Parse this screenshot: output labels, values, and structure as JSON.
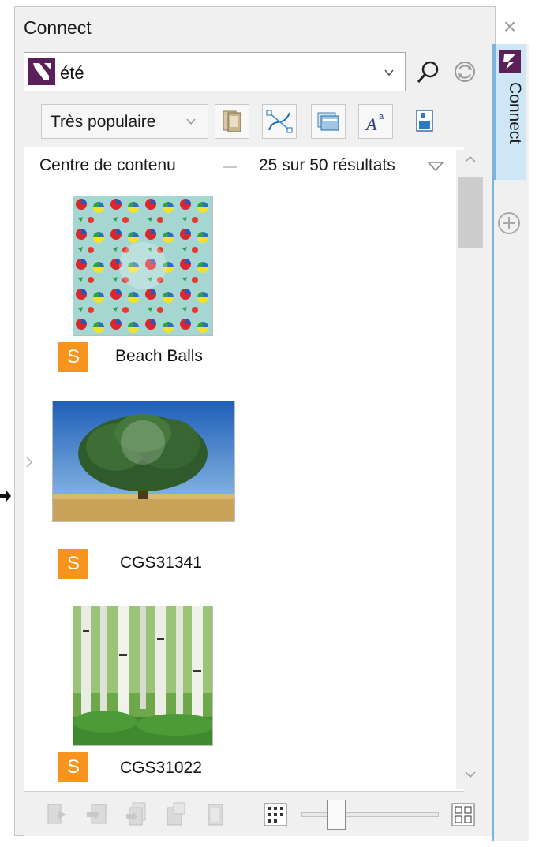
{
  "window": {
    "title": "Connect"
  },
  "side_tab": {
    "label": "Connect"
  },
  "search": {
    "value": "été"
  },
  "toolbar": {
    "sort_label": "Très populaire"
  },
  "content": {
    "source_label": "Centre de contenu",
    "result_count": "25 sur 50 résultats"
  },
  "items": [
    {
      "name": "Beach Balls",
      "badge": "S"
    },
    {
      "name": "CGS31341",
      "badge": "S"
    },
    {
      "name": "CGS31022",
      "badge": "S"
    }
  ],
  "zoom": {
    "level": 0.25
  },
  "colors": {
    "badge": "#f7941d",
    "accent": "#7cb4e0",
    "brand": "#5b1f5a"
  },
  "icons": [
    "close-icon",
    "connect-logo-icon",
    "search-icon",
    "sync-icon",
    "chevron-down-icon",
    "fonts-icon",
    "vector-icon",
    "bitmap-icon",
    "text-icon",
    "save-icon",
    "add-icon",
    "scroll-up-icon",
    "scroll-down-icon",
    "chevron-right-icon",
    "grid-small-icon",
    "grid-large-icon"
  ]
}
